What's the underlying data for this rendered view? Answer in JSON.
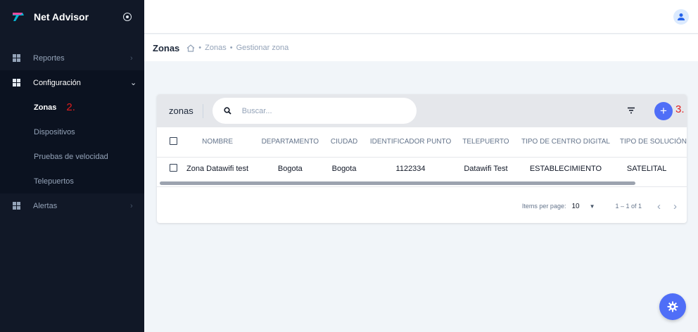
{
  "app": {
    "title": "Net Advisor"
  },
  "sidebar": {
    "items": [
      {
        "label": "Reportes"
      },
      {
        "label": "Configuración"
      },
      {
        "label": "Alertas"
      }
    ],
    "config_children": [
      {
        "label": "Zonas",
        "annotation": "2."
      },
      {
        "label": "Dispositivos"
      },
      {
        "label": "Pruebas de velocidad"
      },
      {
        "label": "Telepuertos"
      }
    ]
  },
  "breadcrumb": {
    "title": "Zonas",
    "path": [
      "Zonas",
      "Gestionar zona"
    ],
    "separator": "•"
  },
  "card": {
    "title": "zonas",
    "search_placeholder": "Buscar...",
    "add_label": "+",
    "add_annotation": "3."
  },
  "table": {
    "columns": [
      "NOMBRE",
      "DEPARTAMENTO",
      "CIUDAD",
      "IDENTIFICADOR PUNTO",
      "TELEPUERTO",
      "TIPO DE CENTRO DIGITAL",
      "TIPO DE SOLUCIÓN"
    ],
    "rows": [
      [
        "Zona Datawifi test",
        "Bogota",
        "Bogota",
        "1122334",
        "Datawifi Test",
        "ESTABLECIMIENTO",
        "SATELITAL"
      ]
    ]
  },
  "paginator": {
    "items_per_page_label": "Items per page:",
    "items_per_page_value": "10",
    "range_label": "1 – 1 of 1",
    "prev": "‹",
    "next": "›"
  },
  "colors": {
    "accent": "#4f6ef7",
    "sidebar_bg": "#111827",
    "annotation": "#e11d1d"
  }
}
